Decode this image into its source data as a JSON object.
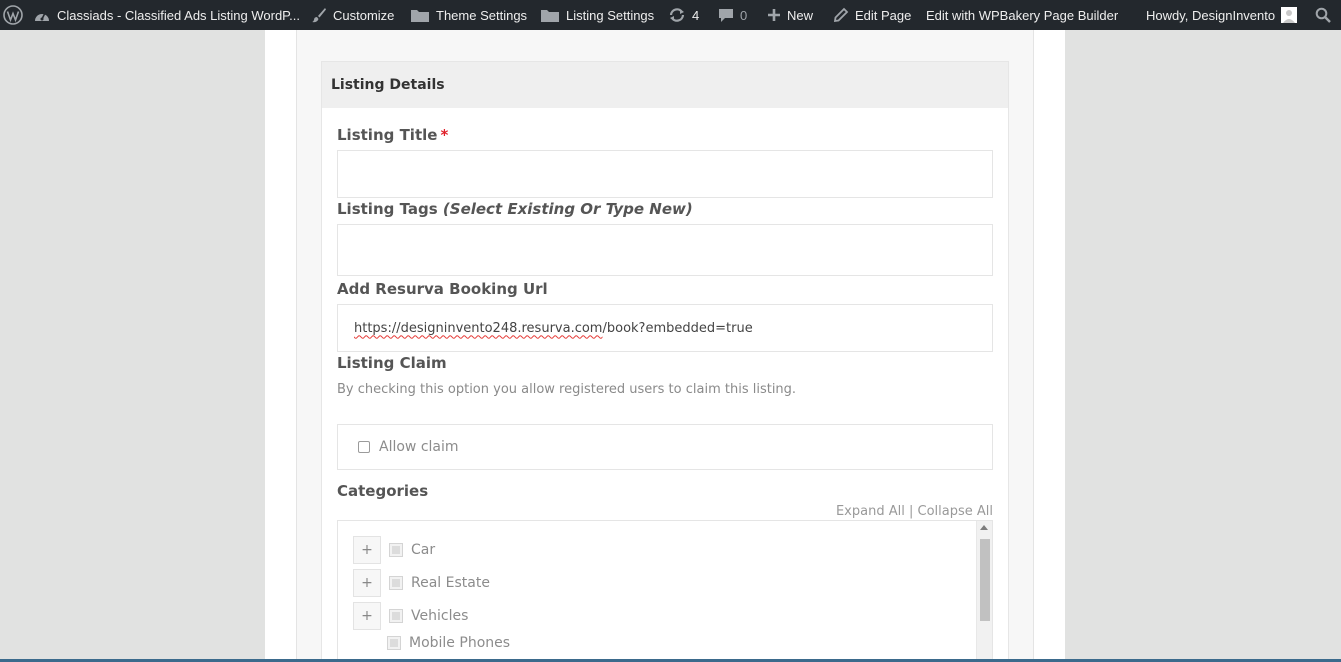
{
  "adminbar": {
    "site_name": "Classiads - Classified Ads Listing WordP...",
    "customize": "Customize",
    "theme_settings": "Theme Settings",
    "listing_settings": "Listing Settings",
    "updates_count": "4",
    "comments_count": "0",
    "new": "New",
    "edit_page": "Edit Page",
    "wpbakery": "Edit with WPBakery Page Builder",
    "howdy": "Howdy, DesignInvento",
    "icons": [
      "wordpress-logo-icon",
      "dashboard-icon",
      "brush-icon",
      "folder-icon",
      "folder-icon",
      "refresh-icon",
      "comment-icon",
      "plus-icon",
      "pencil-icon",
      "avatar-icon",
      "search-icon"
    ]
  },
  "panel": {
    "title": "Listing Details",
    "listing_title": {
      "label": "Listing Title",
      "required_mark": "*",
      "value": ""
    },
    "listing_tags": {
      "label": "Listing Tags",
      "hint": "(Select Existing Or Type New)",
      "value": ""
    },
    "booking_url": {
      "label": "Add Resurva Booking Url",
      "value_wavy": "https://designinvento248.resurva.com",
      "value_rest": "/book?embedded=true"
    },
    "listing_claim": {
      "label": "Listing Claim",
      "help": "By checking this option you allow registered users to claim this listing.",
      "checkbox_label": "Allow claim",
      "checked": false
    },
    "categories": {
      "label": "Categories",
      "expand_all": "Expand All",
      "separator": "|",
      "collapse_all": "Collapse All",
      "items": [
        {
          "name": "Car",
          "expandable": true,
          "expand_symbol": "+"
        },
        {
          "name": "Real Estate",
          "expandable": true,
          "expand_symbol": "+"
        },
        {
          "name": "Vehicles",
          "expandable": true,
          "expand_symbol": "+"
        },
        {
          "name": "Mobile Phones",
          "expandable": false
        }
      ]
    }
  },
  "colors": {
    "adminbar_bg": "#23282d",
    "required": "#e0202a",
    "panel_header_bg": "#efefef"
  }
}
